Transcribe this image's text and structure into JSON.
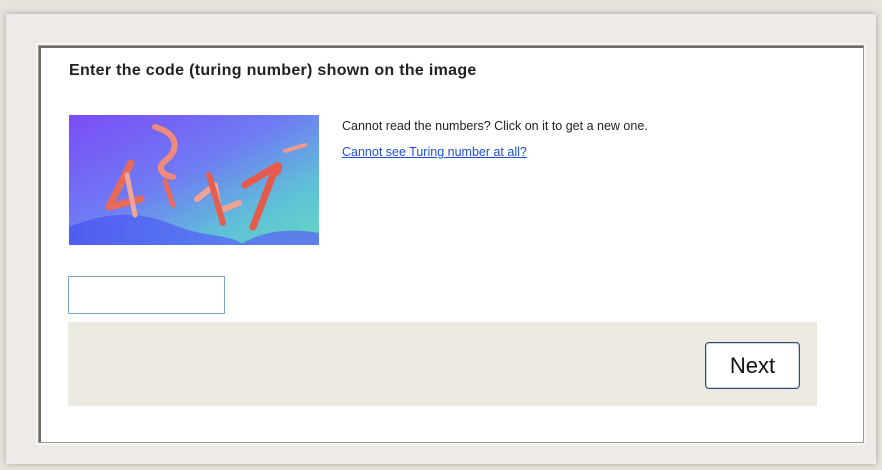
{
  "form": {
    "heading": "Enter the code (turing number) shown on the image",
    "help_text": "Cannot read the numbers? Click on it to get a new one.",
    "help_link": "Cannot see Turing number at all?",
    "code_input": {
      "value": "",
      "placeholder": ""
    },
    "captcha": {
      "code_text": "4247",
      "accent_color": "#7a5cf0"
    },
    "next_label": "Next"
  },
  "colors": {
    "link": "#1d4fd1",
    "footer_bg": "#ebe9e0",
    "input_border": "#7aa3d3"
  }
}
